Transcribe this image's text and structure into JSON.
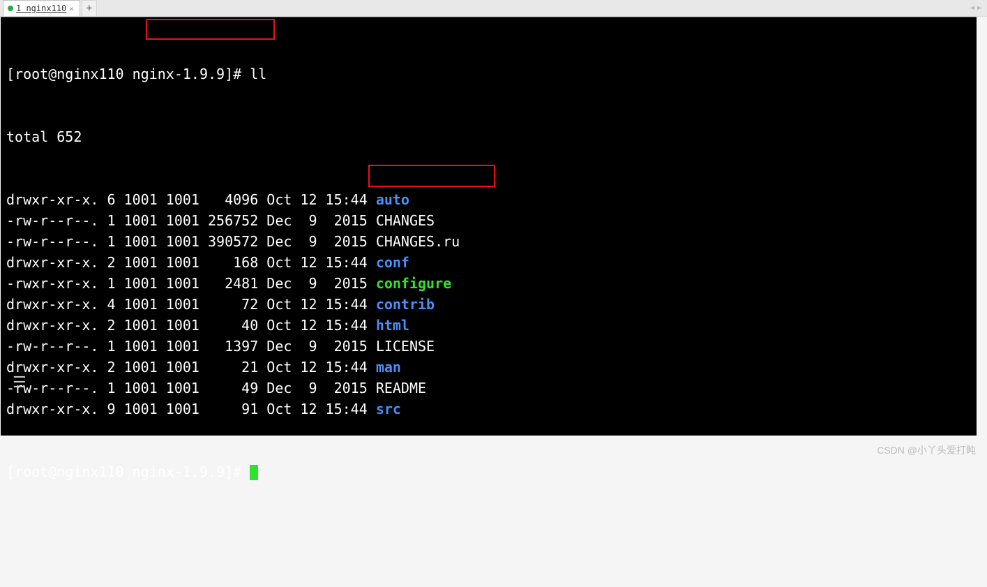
{
  "tab": {
    "label": "1 nginx110",
    "close_glyph": "×",
    "add_glyph": "+"
  },
  "nav": {
    "left": "◀",
    "right": "▶"
  },
  "prompt": {
    "user_host": "[root@nginx110",
    "cwd": " nginx-1.9.9",
    "suffix": "]# ",
    "cmd": "ll"
  },
  "total_line": "total 652",
  "listing": [
    {
      "meta": "drwxr-xr-x. 6 1001 1001   4096 Oct 12 15:44 ",
      "name": "auto",
      "cls": "dir"
    },
    {
      "meta": "-rw-r--r--. 1 1001 1001 256752 Dec  9  2015 ",
      "name": "CHANGES",
      "cls": "plain"
    },
    {
      "meta": "-rw-r--r--. 1 1001 1001 390572 Dec  9  2015 ",
      "name": "CHANGES.ru",
      "cls": "plain"
    },
    {
      "meta": "drwxr-xr-x. 2 1001 1001    168 Oct 12 15:44 ",
      "name": "conf",
      "cls": "dir"
    },
    {
      "meta": "-rwxr-xr-x. 1 1001 1001   2481 Dec  9  2015 ",
      "name": "configure",
      "cls": "exec"
    },
    {
      "meta": "drwxr-xr-x. 4 1001 1001     72 Oct 12 15:44 ",
      "name": "contrib",
      "cls": "dir"
    },
    {
      "meta": "drwxr-xr-x. 2 1001 1001     40 Oct 12 15:44 ",
      "name": "html",
      "cls": "dir"
    },
    {
      "meta": "-rw-r--r--. 1 1001 1001   1397 Dec  9  2015 ",
      "name": "LICENSE",
      "cls": "plain"
    },
    {
      "meta": "drwxr-xr-x. 2 1001 1001     21 Oct 12 15:44 ",
      "name": "man",
      "cls": "dir"
    },
    {
      "meta": "-rw-r--r--. 1 1001 1001     49 Dec  9  2015 ",
      "name": "README",
      "cls": "plain"
    },
    {
      "meta": "drwxr-xr-x. 9 1001 1001     91 Oct 12 15:44 ",
      "name": "src",
      "cls": "dir"
    }
  ],
  "prompt2": "[root@nginx110 nginx-1.9.9]# ",
  "list_icon": "☰",
  "watermark": "CSDN @小丫头爱打盹"
}
